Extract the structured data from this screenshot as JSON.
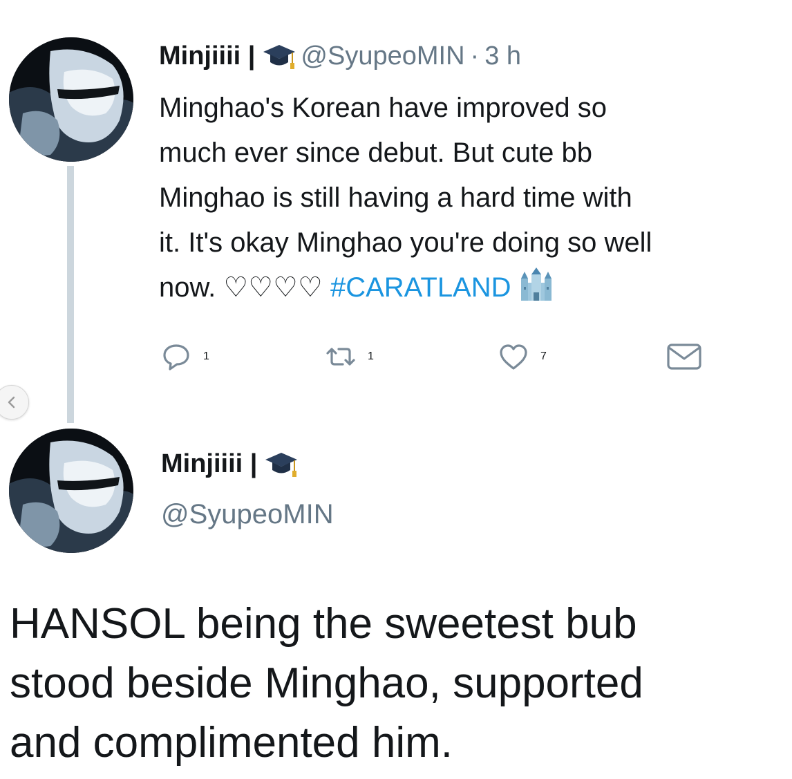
{
  "tweet1": {
    "display_name": "Minjiiii |",
    "badge_icon": "graduation-cap-icon",
    "handle": "@SyupeoMIN",
    "separator": "·",
    "time": "3 h",
    "body_lines": [
      "Minghao's Korean have improved so",
      "much ever since debut. But cute bb",
      "Minghao is still having a hard time with",
      "it. It's okay Minghao you're doing so well"
    ],
    "body_last_prefix": "now. ♡♡♡♡",
    "hashtag": "#CARATLAND",
    "end_icon": "castle-icon",
    "actions": {
      "reply_count": "1",
      "retweet_count": "1",
      "like_count": "7"
    }
  },
  "tweet2": {
    "display_name": "Minjiiii |",
    "badge_icon": "graduation-cap-icon",
    "handle": "@SyupeoMIN",
    "body_lines": [
      "HANSOL being the sweetest bub",
      "stood beside Minghao, supported",
      "and complimented him."
    ]
  },
  "colors": {
    "text": "#14171a",
    "muted": "#657786",
    "link": "#1b95e0",
    "thread_line": "#ccd6dd"
  }
}
